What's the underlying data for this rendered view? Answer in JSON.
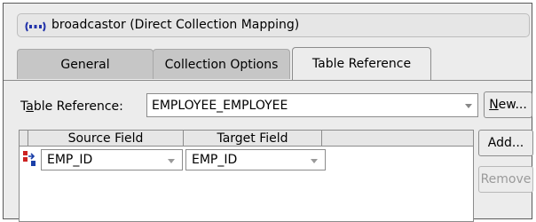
{
  "header": {
    "title": "broadcastor (Direct Collection Mapping)",
    "icon": "mapping-icon"
  },
  "tabs": [
    {
      "label": "General",
      "active": false
    },
    {
      "label": "Collection Options",
      "active": false
    },
    {
      "label": "Table Reference",
      "active": true
    }
  ],
  "table_reference": {
    "label_prefix": "T",
    "label_mnemonic": "a",
    "label_rest": "ble Reference:",
    "value": "EMPLOYEE_EMPLOYEE"
  },
  "buttons": {
    "new_mnemonic": "N",
    "new_rest": "ew...",
    "add": "Add...",
    "remove": "Remove",
    "remove_enabled": false
  },
  "table": {
    "columns": [
      "Source Field",
      "Target Field"
    ],
    "rows": [
      {
        "source": "EMP_ID",
        "target": "EMP_ID",
        "icon": "key-mapping-icon"
      }
    ]
  },
  "colors": {
    "panel": "#ececec",
    "tab_inactive": "#c6c6c6",
    "border": "#8c8c8c"
  }
}
